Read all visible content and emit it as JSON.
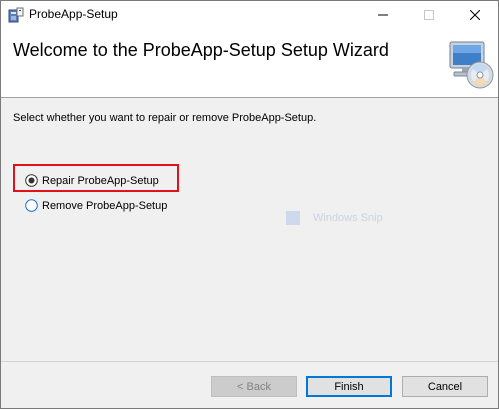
{
  "window": {
    "title": "ProbeApp-Setup",
    "wizard_title": "Welcome to the ProbeApp-Setup Setup Wizard"
  },
  "icons": {
    "app": "installer-icon",
    "banner": "computer-cd-icon",
    "minimize": "minimize-icon",
    "maximize": "maximize-icon",
    "close": "close-icon"
  },
  "main": {
    "instruction": "Select whether you want to repair or remove ProbeApp-Setup.",
    "options": [
      {
        "label": "Repair ProbeApp-Setup",
        "selected": true,
        "highlighted": true
      },
      {
        "label": "Remove ProbeApp-Setup",
        "selected": false,
        "highlighted": false
      }
    ],
    "ghost_text": "Windows Snip"
  },
  "footer": {
    "back_label": "< Back",
    "back_enabled": false,
    "finish_label": "Finish",
    "cancel_label": "Cancel"
  },
  "colors": {
    "highlight": "#e0131b",
    "focus": "#0078d7",
    "radio_unselected": "#1d6fd1"
  }
}
